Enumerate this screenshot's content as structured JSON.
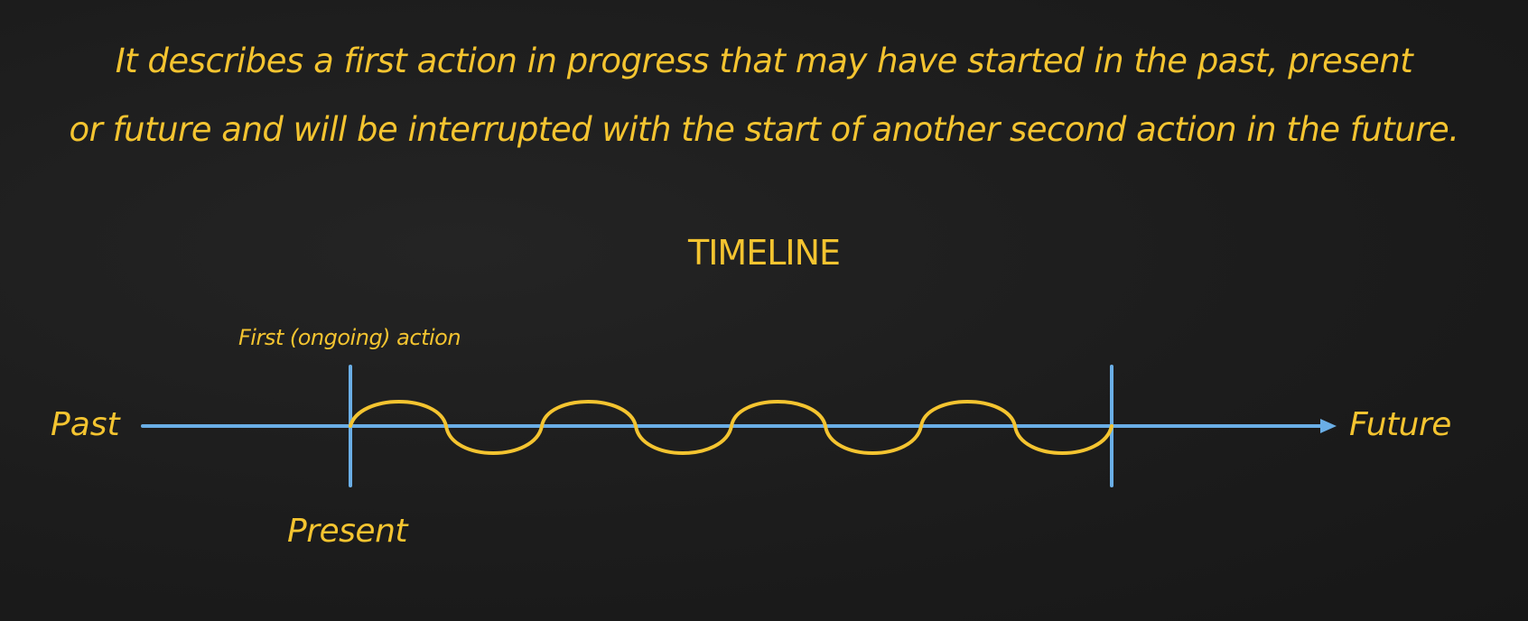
{
  "description": {
    "line1": "It describes a first action in progress that may have started in the past, present",
    "line2": "or future and will be interrupted with the start of another second action in the future."
  },
  "timeline": {
    "title": "TIMELINE",
    "first_action_label": "First (ongoing) action",
    "start_label": "Past",
    "end_label": "Future",
    "marker_label": "Present"
  },
  "colors": {
    "background": "#1b1b1b",
    "text": "#f4c430",
    "axis": "#6aaee6",
    "wave": "#f4c430"
  }
}
